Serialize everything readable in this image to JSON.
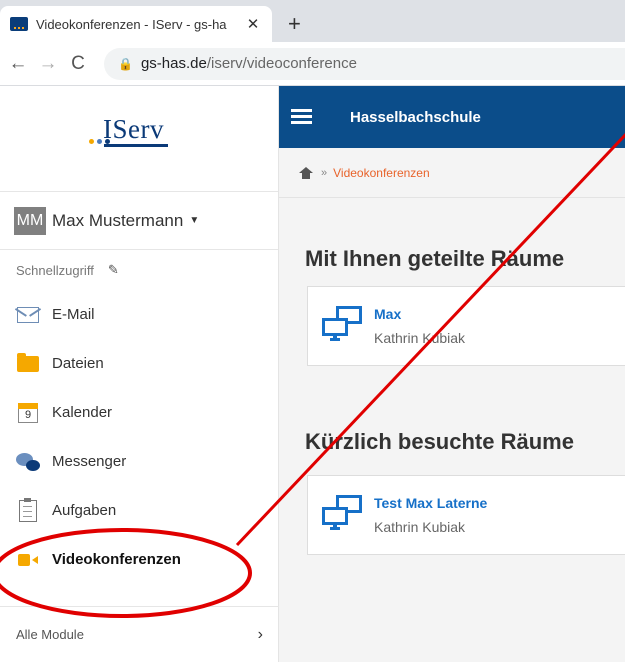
{
  "browser": {
    "tab_title": "Videokonferenzen - IServ - gs-ha",
    "tab_close": "✕",
    "new_tab": "+",
    "back": "←",
    "forward": "→",
    "reload": "C",
    "url_host": "gs-has.de",
    "url_path": "/iserv/videoconference"
  },
  "sidebar": {
    "logo": "IServ",
    "user": {
      "initials": "MM",
      "name": "Max Mustermann"
    },
    "quick_label": "Schnellzugriff",
    "items": [
      {
        "label": "E-Mail",
        "icon": "mail-icon"
      },
      {
        "label": "Dateien",
        "icon": "folder-icon"
      },
      {
        "label": "Kalender",
        "icon": "calendar-icon",
        "icon_text": "9"
      },
      {
        "label": "Messenger",
        "icon": "messenger-icon"
      },
      {
        "label": "Aufgaben",
        "icon": "tasks-icon"
      },
      {
        "label": "Videokonferenzen",
        "icon": "video-icon"
      }
    ],
    "modules_label": "Alle Module"
  },
  "main": {
    "school": "Hasselbachschule",
    "breadcrumb_sep": "»",
    "breadcrumb": "Videokonferenzen",
    "shared_title": "Mit Ihnen geteilte Räume",
    "shared_rooms": [
      {
        "title": "Max",
        "owner": "Kathrin Kubiak"
      }
    ],
    "recent_title": "Kürzlich besuchte Räume",
    "recent_rooms": [
      {
        "title": "Test Max Laterne",
        "owner": "Kathrin Kubiak"
      }
    ]
  },
  "colors": {
    "brand_blue": "#0b4d8a",
    "accent_orange": "#e8632b",
    "link_blue": "#1670c8",
    "annotation_red": "#e00000"
  }
}
